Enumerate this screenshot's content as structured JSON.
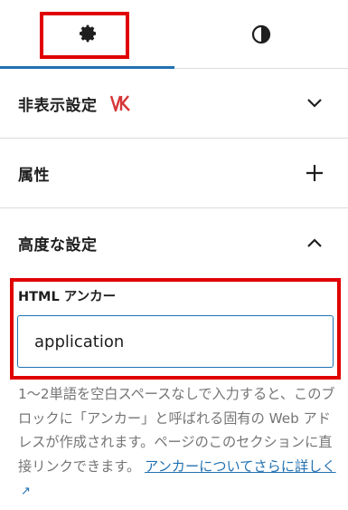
{
  "tabs": {
    "settings": {
      "icon": "gear-icon"
    },
    "styles": {
      "icon": "half-contrast-icon"
    }
  },
  "panels": {
    "hide": {
      "title": "非表示設定",
      "badge": "VK",
      "toggle_icon": "chevron-down-icon"
    },
    "attributes": {
      "title": "属性",
      "toggle_icon": "plus-icon"
    },
    "advanced": {
      "title": "高度な設定",
      "toggle_icon": "chevron-up-icon"
    }
  },
  "html_anchor": {
    "label": "HTML アンカー",
    "value": "application",
    "help_text": "1〜2単語を空白スペースなしで入力すると、このブロックに「アンカー」と呼ばれる固有の Web アドレスが作成されます。ページのこのセクションに直接リンクできます。",
    "help_link": "アンカーについてさらに詳しく",
    "help_link_icon": "external-link-icon"
  },
  "colors": {
    "accent": "#2271b1",
    "highlight": "#e00000",
    "muted_text": "#757575"
  }
}
